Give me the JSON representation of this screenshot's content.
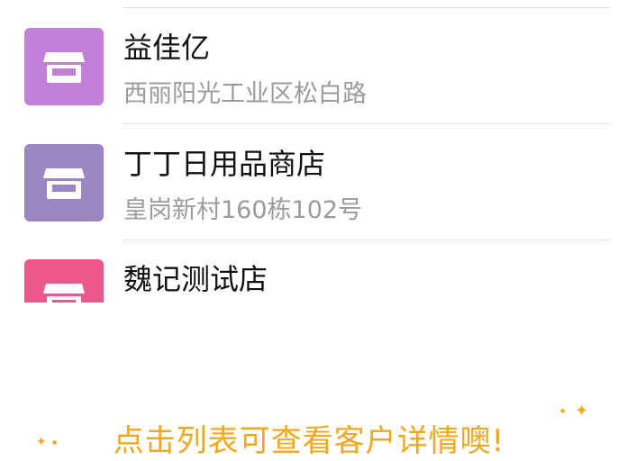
{
  "stores": [
    {
      "name": "益佳亿",
      "address": "西丽阳光工业区松白路",
      "color": "#c47fd9",
      "icon": "store-icon"
    },
    {
      "name": "丁丁日用品商店",
      "address": "皇岗新村160栋102号",
      "color": "#9b86c2",
      "icon": "store-icon"
    },
    {
      "name": "魏记测试店",
      "address": "",
      "color": "#f0588a",
      "icon": "store-icon"
    }
  ],
  "hint": {
    "text": "点击列表可查看客户详情噢!",
    "color": "#f2a81c"
  }
}
